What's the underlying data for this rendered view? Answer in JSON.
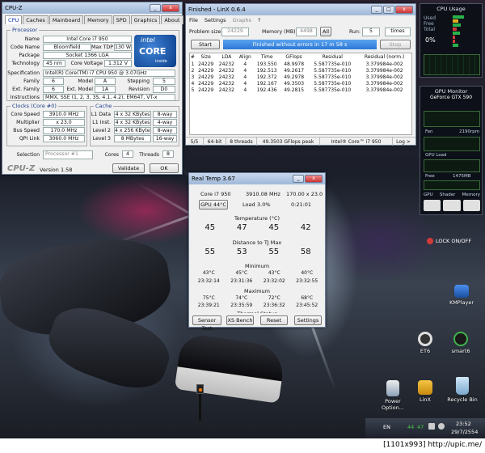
{
  "cpuz": {
    "title": "CPU-Z",
    "tabs": [
      "CPU",
      "Caches",
      "Mainboard",
      "Memory",
      "SPD",
      "Graphics",
      "About"
    ],
    "processor": {
      "group_label": "Processor",
      "name_label": "Name",
      "name": "Intel Core i7 950",
      "codename_label": "Code Name",
      "codename": "Bloomfield",
      "maxtdp_label": "Max TDP",
      "maxtdp": "130 W",
      "package_label": "Package",
      "package": "Socket 1366 LGA",
      "technology_label": "Technology",
      "technology": "45 nm",
      "corevoltage_label": "Core Voltage",
      "corevoltage": "1.312 V",
      "spec_label": "Specification",
      "spec": "Intel(R) Core(TM) i7 CPU        950  @ 3.07GHz",
      "family_label": "Family",
      "family": "6",
      "model_label": "Model",
      "model": "A",
      "stepping_label": "Stepping",
      "stepping": "5",
      "extfamily_label": "Ext. Family",
      "extfamily": "6",
      "extmodel_label": "Ext. Model",
      "extmodel": "1A",
      "revision_label": "Revision",
      "revision": "D0",
      "instructions_label": "Instructions",
      "instructions": "MMX, SSE (1, 2, 3, 3S, 4.1, 4.2), EM64T, VT-x"
    },
    "intel_logo": {
      "l1": "intel",
      "l2": "CORE",
      "l3": "i7",
      "l4": "inside"
    },
    "clocks": {
      "group_label": "Clocks (Core #0)",
      "corespeed_label": "Core Speed",
      "corespeed": "3910.0 MHz",
      "multiplier_label": "Multiplier",
      "multiplier": "x 23.0",
      "busspeed_label": "Bus Speed",
      "busspeed": "170.0 MHz",
      "qpilink_label": "QPI Link",
      "qpilink": "3060.0 MHz"
    },
    "cache": {
      "group_label": "Cache",
      "rows": [
        {
          "level": "L1 Data",
          "size": "4 x 32 KBytes",
          "ways": "8-way"
        },
        {
          "level": "L1 Inst.",
          "size": "4 x 32 KBytes",
          "ways": "4-way"
        },
        {
          "level": "Level 2",
          "size": "4 x 256 KBytes",
          "ways": "8-way"
        },
        {
          "level": "Level 3",
          "size": "8 MBytes",
          "ways": "16-way"
        }
      ]
    },
    "selection_label": "Selection",
    "selection": "Processor #1",
    "cores_label": "Cores",
    "cores": "4",
    "threads_label": "Threads",
    "threads": "8",
    "brand": "CPU-Z",
    "version": "Version 1.58",
    "validate": "Validate",
    "ok": "OK"
  },
  "linx": {
    "title": "Finished - LinX 0.6.4",
    "menu": [
      "File",
      "Settings",
      "Graphs",
      "?"
    ],
    "problem_size_label": "Problem size:",
    "problem_size": "24229",
    "memory_label": "Memory (MB):",
    "memory": "4498",
    "all_label": "All",
    "run_label": "Run:",
    "run": "5",
    "run_unit": "times",
    "start": "Start",
    "status": "Finished without errors in 17 m 58 s",
    "stop": "Stop",
    "columns": [
      "#",
      "Size",
      "LDA",
      "Align",
      "Time",
      "GFlops",
      "Residual",
      "Residual (norm.)"
    ],
    "rows": [
      [
        "1",
        "24229",
        "24232",
        "4",
        "193.550",
        "48.9978",
        "5.587735e-010",
        "3.379984e-002"
      ],
      [
        "2",
        "24229",
        "24232",
        "4",
        "192.513",
        "49.2617",
        "5.587735e-010",
        "3.379984e-002"
      ],
      [
        "3",
        "24229",
        "24232",
        "4",
        "192.372",
        "49.2978",
        "5.587735e-010",
        "3.379984e-002"
      ],
      [
        "4",
        "24229",
        "24232",
        "4",
        "192.167",
        "49.3503",
        "5.587735e-010",
        "3.379984e-002"
      ],
      [
        "5",
        "24229",
        "24232",
        "4",
        "192.436",
        "49.2815",
        "5.587735e-010",
        "3.379984e-002"
      ]
    ],
    "statusbar": [
      "5/5",
      "64-bit",
      "8 threads",
      "49.3503 GFlops peak",
      "Intel® Core™ i7 950",
      "Log >"
    ]
  },
  "realtemp": {
    "title": "Real Temp 3.67",
    "cpu": "Core i7 950",
    "freq": "3910.08 MHz",
    "multi": "170.00 x 23.0",
    "gpu_button": "GPU 44°C",
    "load_label": "Load",
    "load": "3.0%",
    "uptime": "0:21:01",
    "temperature_label": "Temperature (°C)",
    "temps": [
      "45",
      "47",
      "45",
      "42"
    ],
    "distance_label": "Distance to TJ Max",
    "distance": [
      "55",
      "53",
      "55",
      "58"
    ],
    "minimum_label": "Minimum",
    "min_temps": [
      "43°C",
      "45°C",
      "43°C",
      "40°C"
    ],
    "min_times": [
      "23:32:14",
      "23:31:36",
      "23:32:02",
      "23:32:55"
    ],
    "maximum_label": "Maximum",
    "max_temps": [
      "75°C",
      "74°C",
      "72°C",
      "68°C"
    ],
    "max_times": [
      "23:39:21",
      "23:35:59",
      "23:36:32",
      "23:45:52"
    ],
    "thermal_label": "Thermal Status",
    "thermal": [
      "OK",
      "OK",
      "OK",
      "OK"
    ],
    "buttons": [
      "Sensor Test",
      "XS Bench",
      "Reset",
      "Settings"
    ]
  },
  "gadgets": {
    "cpu_title": "CPU Usage",
    "cpu_pct": "0%",
    "cpu_fields": [
      "Used",
      "Free",
      "Total"
    ],
    "gpu_title": "GPU Monitor",
    "gpu_name": "GeForce GTX 590",
    "gpu_labels": [
      "Fan",
      "GPU Load",
      "Free",
      "GPU",
      "Shader",
      "Memory"
    ],
    "gpu_values": [
      "2190rpm",
      "1475MB"
    ],
    "lock": "LOCK ON/OFF"
  },
  "desktop_icons": [
    "KMPlayer",
    "ET6",
    "smart6",
    "Power Option...",
    "LinX",
    "Recycle Bin"
  ],
  "taskbar": {
    "lang": "EN",
    "time": "23:52",
    "date": "29/7/2554",
    "tray": [
      "44",
      "47"
    ]
  },
  "footer": {
    "text": "[1101x993] http://upic.me/"
  }
}
